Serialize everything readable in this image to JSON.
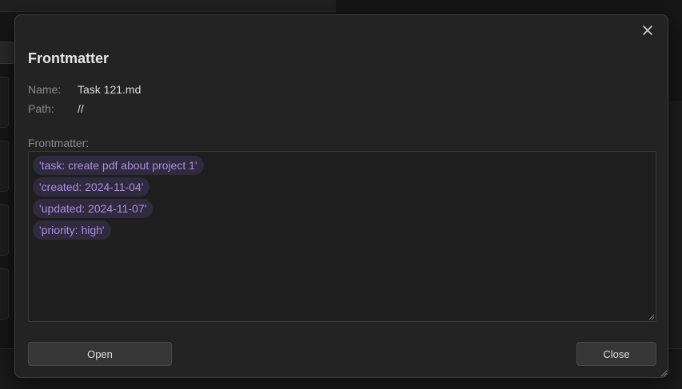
{
  "modal": {
    "title": "Frontmatter",
    "name_label": "Name:",
    "name_value": "Task 121.md",
    "path_label": "Path:",
    "path_value": "//",
    "frontmatter_label": "Frontmatter:",
    "frontmatter_items": [
      "'task: create pdf about project 1'",
      "'created: 2024-11-04'",
      "'updated: 2024-11-07'",
      "'priority: high'"
    ],
    "open_button": "Open",
    "close_button": "Close"
  },
  "colors": {
    "modal_bg": "#232323",
    "tag_bg": "#302a3f",
    "tag_text": "#a98ee0",
    "bg_link_purple": "#a06cd5",
    "bg_link_blue": "#3d7fd6"
  }
}
